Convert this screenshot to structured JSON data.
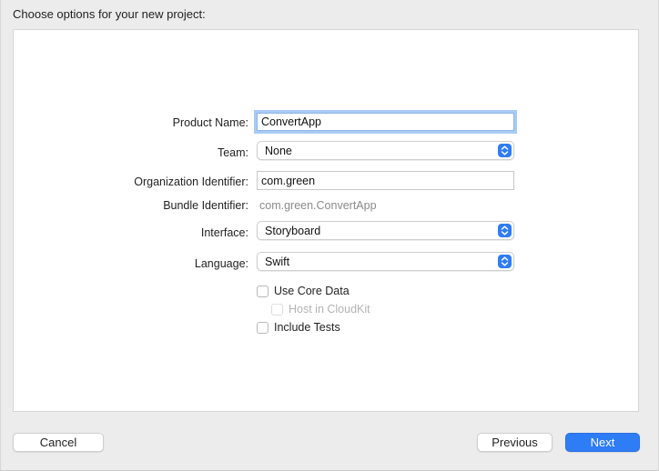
{
  "header": {
    "title": "Choose options for your new project:"
  },
  "form": {
    "product_name": {
      "label": "Product Name:",
      "value": "ConvertApp"
    },
    "team": {
      "label": "Team:",
      "value": "None"
    },
    "organization_identifier": {
      "label": "Organization Identifier:",
      "value": "com.green"
    },
    "bundle_identifier": {
      "label": "Bundle Identifier:",
      "value": "com.green.ConvertApp"
    },
    "interface": {
      "label": "Interface:",
      "value": "Storyboard"
    },
    "language": {
      "label": "Language:",
      "value": "Swift"
    },
    "options": [
      {
        "label": "Use Core Data",
        "checked": false,
        "enabled": true
      },
      {
        "label": "Host in CloudKit",
        "checked": false,
        "enabled": false
      },
      {
        "label": "Include Tests",
        "checked": false,
        "enabled": true
      }
    ]
  },
  "footer": {
    "cancel_label": "Cancel",
    "previous_label": "Previous",
    "next_label": "Next"
  },
  "colors": {
    "accent": "#2e7cf6",
    "focus_ring": "#a9cbf3",
    "window_background": "#ececec",
    "panel_background": "#ffffff"
  },
  "icons": {
    "popup_indicator": "chevron-up-down-icon"
  }
}
